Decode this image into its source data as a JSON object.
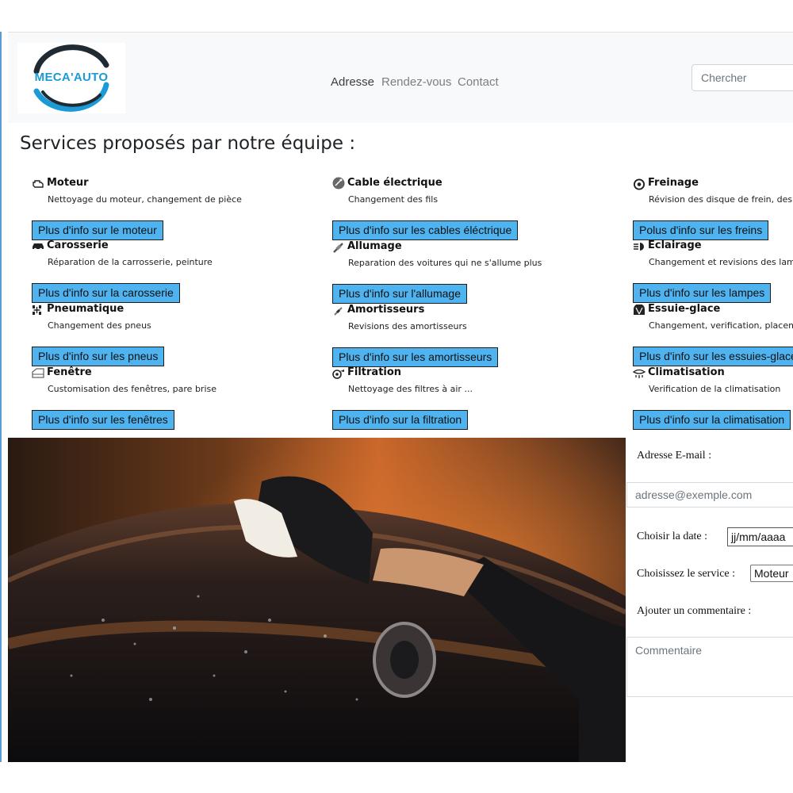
{
  "header": {
    "logo_text": "MECA'AUTO",
    "nav": {
      "adresse": "Adresse",
      "rdv": "Rendez-vous",
      "contact": "Contact"
    },
    "search_placeholder": "Chercher"
  },
  "services_section": {
    "title": "Services proposés par notre équipe :",
    "items": [
      {
        "icon": "engine-icon",
        "title": "Moteur",
        "desc": "Nettoyage du moteur, changement de pièce",
        "button": "Plus d'info sur le moteur"
      },
      {
        "icon": "cable-icon",
        "title": "Cable électrique",
        "desc": "Changement des fils",
        "button": "Plus d'info sur les cables éléctrique"
      },
      {
        "icon": "brake-disc-icon",
        "title": "Freinage",
        "desc": "Révision des disque de frein, des c",
        "button": "Polus d'info sur les freins"
      },
      {
        "icon": "car-icon",
        "title": "Carosserie",
        "desc": "Réparation de la carrosserie, peinture",
        "button": "Plus d'info sur la carosserie"
      },
      {
        "icon": "spark-plug-icon",
        "title": "Allumage",
        "desc": "Reparation des voitures qui ne s'allume plus",
        "button": "Plus d'info sur l'allumage"
      },
      {
        "icon": "headlight-icon",
        "title": "Eclairage",
        "desc": "Changement et revisions des lamp",
        "button": "Plus d'info sur les lampes"
      },
      {
        "icon": "tire-axle-icon",
        "title": "Pneumatique",
        "desc": "Changement des pneus",
        "button": "Plus d'info sur les pneus"
      },
      {
        "icon": "shock-absorber-icon",
        "title": "Amortisseurs",
        "desc": "Revisions des amortisseurs",
        "button": "Plus d'info sur les amortisseurs"
      },
      {
        "icon": "wiper-icon",
        "title": "Essuie-glace",
        "desc": "Changement, verification, placeme",
        "button": "Plus d'info sur les essuies-glace"
      },
      {
        "icon": "window-icon",
        "title": "Fenêtre",
        "desc": "Customisation des fenêtres, pare brise",
        "button": "Plus d'info sur les fenêtres"
      },
      {
        "icon": "filter-icon",
        "title": "Filtration",
        "desc": "Nettoyage des filtres à air ...",
        "button": "Plus d'info sur la filtration"
      },
      {
        "icon": "ac-icon",
        "title": "Climatisation",
        "desc": "Verification de la climatisation",
        "button": "Plus d'info sur la climatisation"
      }
    ]
  },
  "form": {
    "email_label": "Adresse E-mail :",
    "email_placeholder": "adresse@exemple.com",
    "date_label": "Choisir la date :",
    "date_value": "jj/mm/aaaa",
    "service_label": "Choisissez le service :",
    "service_value": "Moteur",
    "comment_label": "Ajouter un commentaire :",
    "comment_placeholder": "Commentaire"
  },
  "colors": {
    "accent_button": "#4fb3f0",
    "logo_blue": "#1b9ad6",
    "navbar_bg": "#f8f9fa"
  }
}
